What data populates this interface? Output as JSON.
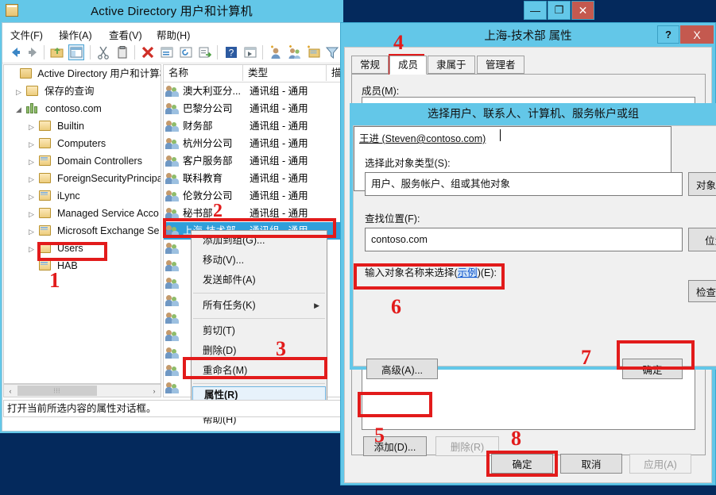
{
  "app": {
    "title": "Active Directory 用户和计算机",
    "icon": "console-icon",
    "window_buttons": {
      "minimize": "—",
      "maximize": "❐",
      "close": "✕"
    }
  },
  "menubar": [
    {
      "label": "文件(F)",
      "name": "menu-file"
    },
    {
      "label": "操作(A)",
      "name": "menu-action"
    },
    {
      "label": "查看(V)",
      "name": "menu-view"
    },
    {
      "label": "帮助(H)",
      "name": "menu-help"
    }
  ],
  "toolbar": {
    "icons": [
      "back-arrow-icon",
      "forward-arrow-icon",
      "up-folder-icon",
      "show-hide-tree-icon",
      "cut-icon",
      "paste-icon",
      "delete-icon",
      "properties-icon",
      "refresh-icon",
      "export-list-icon",
      "help-icon",
      "console-window-icon",
      "new-user-icon",
      "new-group-icon",
      "new-ou-icon",
      "filter-icon"
    ]
  },
  "tree": {
    "items": [
      {
        "label": "Active Directory 用户和计算机",
        "indent": 0,
        "twisty": "",
        "icon": "console-root-icon"
      },
      {
        "label": "保存的查询",
        "indent": 1,
        "twisty": "▷",
        "icon": "folder-icon"
      },
      {
        "label": "contoso.com",
        "indent": 1,
        "twisty": "◢",
        "icon": "domain-icon"
      },
      {
        "label": "Builtin",
        "indent": 2,
        "twisty": "▷",
        "icon": "folder-icon"
      },
      {
        "label": "Computers",
        "indent": 2,
        "twisty": "▷",
        "icon": "folder-icon"
      },
      {
        "label": "Domain Controllers",
        "indent": 2,
        "twisty": "▷",
        "icon": "ou-icon"
      },
      {
        "label": "ForeignSecurityPrincipa",
        "indent": 2,
        "twisty": "▷",
        "icon": "folder-icon"
      },
      {
        "label": "iLync",
        "indent": 2,
        "twisty": "▷",
        "icon": "ou-icon"
      },
      {
        "label": "Managed Service Acco",
        "indent": 2,
        "twisty": "▷",
        "icon": "folder-icon"
      },
      {
        "label": "Microsoft Exchange Se",
        "indent": 2,
        "twisty": "▷",
        "icon": "ou-icon"
      },
      {
        "label": "Users",
        "indent": 2,
        "twisty": "▷",
        "icon": "folder-icon"
      },
      {
        "label": "HAB",
        "indent": 2,
        "twisty": "",
        "icon": "ou-icon"
      }
    ],
    "hscroll": {
      "left_arrow": "‹",
      "right_arrow": "›",
      "thumb": "⦙⦙⦙"
    }
  },
  "list": {
    "columns": [
      {
        "label": "名称",
        "name": "column-name"
      },
      {
        "label": "类型",
        "name": "column-type"
      },
      {
        "label": "描",
        "name": "column-description"
      }
    ],
    "rows": [
      {
        "name": "澳大利亚分...",
        "type": "通讯组 - 通用"
      },
      {
        "name": "巴黎分公司",
        "type": "通讯组 - 通用"
      },
      {
        "name": "财务部",
        "type": "通讯组 - 通用"
      },
      {
        "name": "杭州分公司",
        "type": "通讯组 - 通用"
      },
      {
        "name": "客户服务部",
        "type": "通讯组 - 通用"
      },
      {
        "name": "联科教育",
        "type": "通讯组 - 通用"
      },
      {
        "name": "伦敦分公司",
        "type": "通讯组 - 通用"
      },
      {
        "name": "秘书部",
        "type": "通讯组 - 通用"
      },
      {
        "name": "上海-技术部",
        "type": "通讯组 - 通用",
        "selected": true
      }
    ]
  },
  "context_menu": {
    "items": [
      {
        "label": "添加到组(G)...",
        "name": "ctx-add-to-group"
      },
      {
        "label": "移动(V)...",
        "name": "ctx-move"
      },
      {
        "label": "发送邮件(A)",
        "name": "ctx-send-mail"
      },
      {
        "separator": true
      },
      {
        "label": "所有任务(K)",
        "name": "ctx-all-tasks",
        "submenu": "▶"
      },
      {
        "separator": true
      },
      {
        "label": "剪切(T)",
        "name": "ctx-cut"
      },
      {
        "label": "删除(D)",
        "name": "ctx-delete"
      },
      {
        "label": "重命名(M)",
        "name": "ctx-rename"
      },
      {
        "separator": true
      },
      {
        "label": "属性(R)",
        "name": "ctx-properties",
        "highlighted": true
      },
      {
        "separator": true
      },
      {
        "label": "帮助(H)",
        "name": "ctx-help"
      }
    ]
  },
  "statusbar": {
    "text": "打开当前所选内容的属性对话框。"
  },
  "properties_dialog": {
    "title": "上海-技术部 属性",
    "help_button": "?",
    "close_button": "X",
    "tabs": [
      {
        "label": "常规",
        "name": "tab-general",
        "active": false
      },
      {
        "label": "成员",
        "name": "tab-members",
        "active": true
      },
      {
        "label": "隶属于",
        "name": "tab-memberof",
        "active": false
      },
      {
        "label": "管理者",
        "name": "tab-managedby",
        "active": false
      }
    ],
    "members_label": "成员(M):",
    "add_button": "添加(D)...",
    "remove_button": "删除(R)",
    "ok_button": "确定",
    "cancel_button": "取消",
    "apply_button": "应用(A)"
  },
  "select_dialog": {
    "title": "选择用户、联系人、计算机、服务帐户或组",
    "object_type_label": "选择此对象类型(S):",
    "object_type_value": "用户、服务帐户、组或其他对象",
    "object_types_button": "对象类",
    "from_location_label": "查找位置(F):",
    "from_location_value": "contoso.com",
    "locations_button": "位置",
    "enter_names_label_prefix": "输入对象名称来选择(",
    "enter_names_label_link": "示例",
    "enter_names_label_suffix": ")(E):",
    "names_value": "王进 (Steven@contoso.com)",
    "check_names_button": "检查",
    "advanced_button": "高级(A)...",
    "ok_button": "确定"
  },
  "annotations": [
    {
      "number": "1",
      "target": "tree-item-hab"
    },
    {
      "number": "2",
      "target": "list-row-selected"
    },
    {
      "number": "3",
      "target": "ctx-properties"
    },
    {
      "number": "4",
      "target": "tab-members"
    },
    {
      "number": "5",
      "target": "add-member-button"
    },
    {
      "number": "6",
      "target": "object-names-input"
    },
    {
      "number": "7",
      "target": "select-dialog-ok-button"
    },
    {
      "number": "8",
      "target": "properties-ok-button"
    }
  ],
  "colors": {
    "title_bar": "#63c7e8",
    "accent_selection": "#2f9fdb",
    "annotation_red": "#e21b1b",
    "desktop": "#04295c",
    "close_button": "#c4594f"
  }
}
